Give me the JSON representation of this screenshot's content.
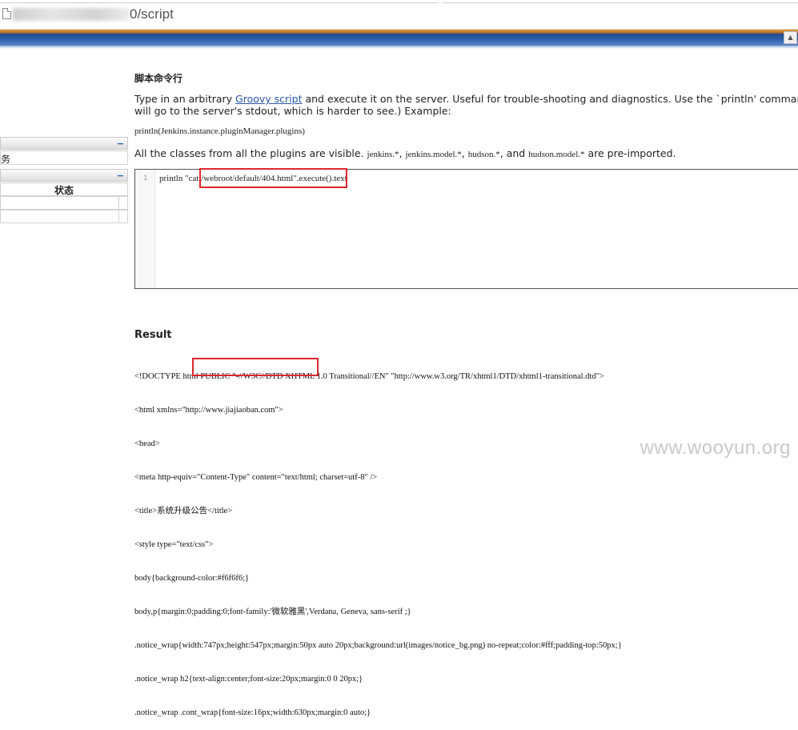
{
  "browser": {
    "url_suffix": "0/script"
  },
  "sidebar": {
    "panel1_collapse": "−",
    "panel1_row_text": "务",
    "panel2_collapse": "−",
    "status_header": "状态"
  },
  "main": {
    "title": "脚本命令行",
    "desc_line1_pre": "Type in an arbitrary ",
    "desc_link": "Groovy script",
    "desc_line1_post": " and execute it on the server. Useful for trouble-shooting and diagnostics. Use the `println' command to se",
    "desc_line2": "will go to the server's stdout, which is harder to see.) Example:",
    "example_code": "println(Jenkins.instance.pluginManager.plugins)",
    "classes_pre": "All the classes from all the plugins are visible. ",
    "classes_pkg1": "jenkins.*",
    "classes_sep1": ", ",
    "classes_pkg2": "jenkins.model.*",
    "classes_sep2": ", ",
    "classes_pkg3": "hudson.*",
    "classes_sep3": ", and ",
    "classes_pkg4": "hudson.model.*",
    "classes_post": " are pre-imported."
  },
  "editor": {
    "line_number": "1",
    "code": "println \"cat /webroot/default/404.html\".execute().text"
  },
  "result": {
    "title": "Result",
    "lines": [
      "<!DOCTYPE html PUBLIC \"-//W3C//DTD XHTML 1.0 Transitional//EN\" \"http://www.w3.org/TR/xhtml1/DTD/xhtml1-transitional.dtd\">",
      "<html xmlns=\"http://www.jiajiaoban.com\">",
      "<head>",
      "<meta http-equiv=\"Content-Type\" content=\"text/html; charset=utf-8\" />",
      "<title>系统升级公告</title>",
      "<style type=\"text/css\">",
      "body{background-color:#f6f6f6;}",
      "body,p{margin:0;padding:0;font-family:'微软雅黑',Verdana, Geneva, sans-serif ;}",
      ".notice_wrap{width:747px;height:547px;margin:50px auto 20px;background:url(images/notice_bg.png) no-repeat;color:#fff;padding-top:50px;}",
      ".notice_wrap h2{text-align:center;font-size:20px;margin:0 0 20px;}",
      ".notice_wrap .cont_wrap{font-size:16px;width:630px;margin:0 auto;}"
    ]
  },
  "watermark": "www.wooyun.org",
  "colors": {
    "link": "#2753a8",
    "highlight_box": "#e0262c",
    "header_blue": "#2f61ad",
    "header_orange": "#e8a23c"
  }
}
